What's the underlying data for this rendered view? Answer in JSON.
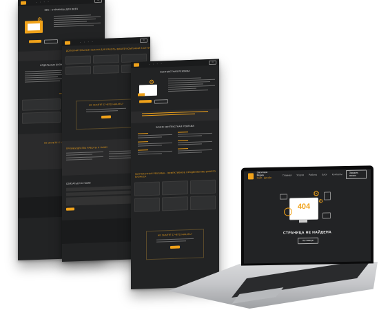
{
  "page1": {
    "hero_title": "ВЕБ - СТРАНИЦЫ ДЛЯ ВСЕХ",
    "section_title": "ОТДЕЛЬНЫЕ БИЗНЕСЫ И КЛИЕНТЫ",
    "cta_title": "НЕ ЗНАЕТЕ С ЧЕГО НАЧАТЬ?"
  },
  "page2": {
    "header": "ДОПОЛНИТЕЛЬНЫЕ УСЛУГИ ДЛЯ РАБОТЫ ВАШЕЙ КОМПАНИИ В СЕТИ",
    "cta_title": "НЕ ЗНАЕТЕ С ЧЕГО НАЧАТЬ?",
    "advantages_title": "ПРЕИМУЩЕСТВА РАБОТЫ С НАМИ",
    "contact_title": "СВЯЗАТЬСЯ С НАМИ"
  },
  "page3": {
    "header": "КОНТЕКСТНАЯ РЕКЛАМА",
    "reasons_title": "ЗАЧЕМ КОНТЕКСТНАЯ РЕКЛАМА",
    "section3_title": "КОНТЕКСТНАЯ РЕКЛАМА - ЭФФЕКТИВНОЕ ПРОДВИЖЕНИЕ ВАШЕГО БИЗНЕСА",
    "cta_title": "НЕ ЗНАЕТЕ С ЧЕГО НАЧАТЬ?"
  },
  "laptop": {
    "brand_line1": "Заголовок Медиа",
    "brand_line2": "Сайт - Дизайн",
    "nav": [
      "Главная",
      "Услуги",
      "Работы",
      "Блог",
      "Контакты"
    ],
    "call_button": "Заказать звонок",
    "error_code": "404",
    "error_title": "СТРАНИЦА НЕ НАЙДЕНА",
    "home_button": "На главную"
  },
  "colors": {
    "accent": "#f0a21a",
    "page_bg": "#222324"
  }
}
